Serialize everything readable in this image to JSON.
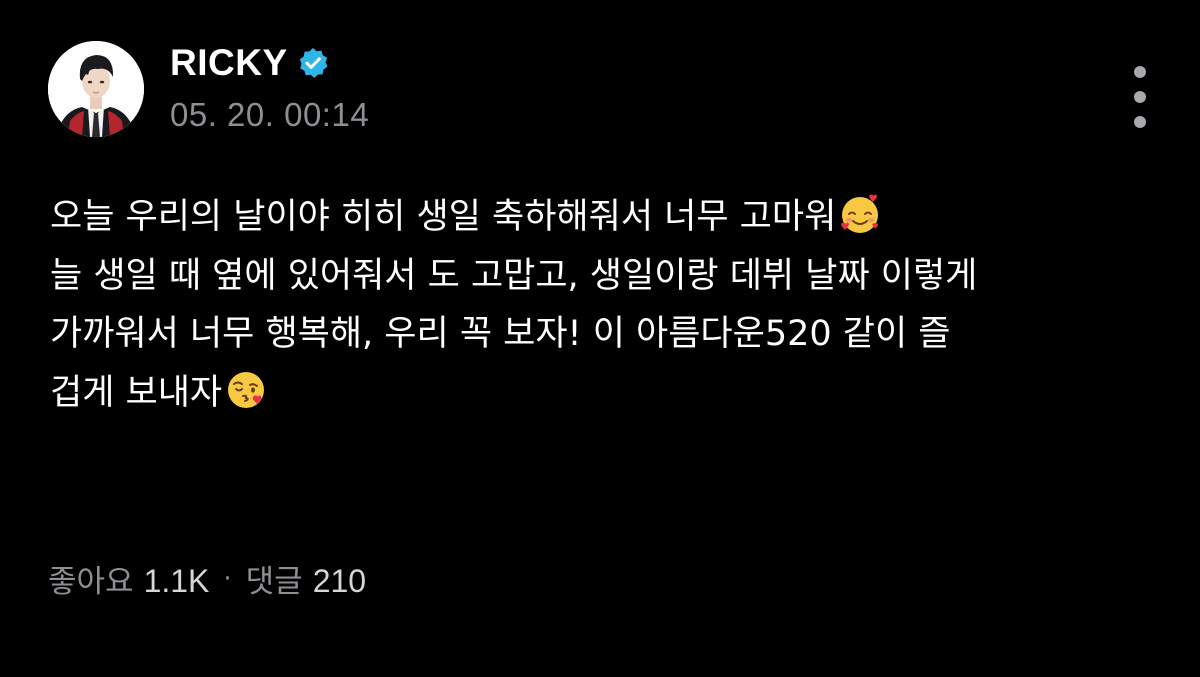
{
  "post": {
    "author": {
      "username": "RICKY",
      "verified": true
    },
    "timestamp": "05. 20. 00:14",
    "body": {
      "line1": "오늘 우리의 날이야 히히 생일 축하해줘서 너무 고마워",
      "line1_emoji": "smiling-face-with-hearts",
      "line2": "늘 생일 때 옆에 있어줘서 도 고맙고, 생일이랑 데뷔 날짜 이렇게",
      "line3": "가까워서 너무 행복해, 우리 꼭 보자! 이 아름다운520 같이 즐",
      "line4": "겁게 보내자",
      "line4_emoji": "face-blowing-a-kiss"
    },
    "stats": {
      "likes_label": "좋아요",
      "likes_count": "1.1K",
      "separator": "·",
      "comments_label": "댓글",
      "comments_count": "210"
    }
  },
  "icons": {
    "verified": "verified-badge-icon",
    "more": "more-vertical-icon"
  },
  "colors": {
    "background": "#000000",
    "text_primary": "#ffffff",
    "text_secondary": "#8e8e93",
    "verified_badge": "#2fb5e8"
  }
}
